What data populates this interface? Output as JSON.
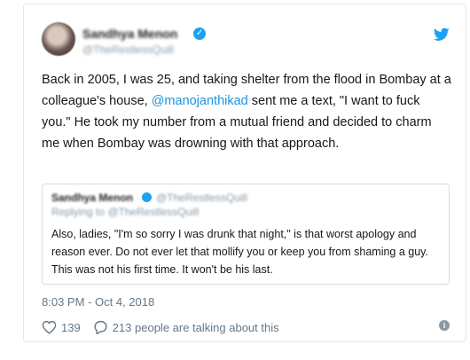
{
  "tweet": {
    "author_name": "Sandhya Menon",
    "author_handle": "@TheRestlessQuill",
    "text_before": "Back in 2005, I was 25, and taking shelter from the flood in Bombay at a colleague's house, ",
    "mention": "@manojanthikad",
    "text_after": " sent me a text, \"I want to fuck you.\" He took my number from a mutual friend and decided to charm me when Bombay was drowning with that approach.",
    "timestamp": "8:03 PM - Oct 4, 2018",
    "like_count": "139",
    "talking_text": "213 people are talking about this"
  },
  "quoted": {
    "author_name": "Sandhya Menon",
    "author_handle": "@TheRestlessQuill",
    "replying_to": "Replying to @TheRestlessQuill",
    "text": "Also, ladies, \"I'm so sorry I was drunk that night,\" is that worst apology and reason ever. Do not ever let that mollify you or keep you from shaming a guy. This was not his first time. It won't be his last."
  },
  "colors": {
    "accent": "#1da1f2",
    "link": "#1b95e0",
    "muted": "#657786"
  },
  "icons": [
    "avatar",
    "verified-badge-icon",
    "twitter-bird-icon",
    "heart-icon",
    "reply-bubble-icon",
    "info-icon"
  ]
}
